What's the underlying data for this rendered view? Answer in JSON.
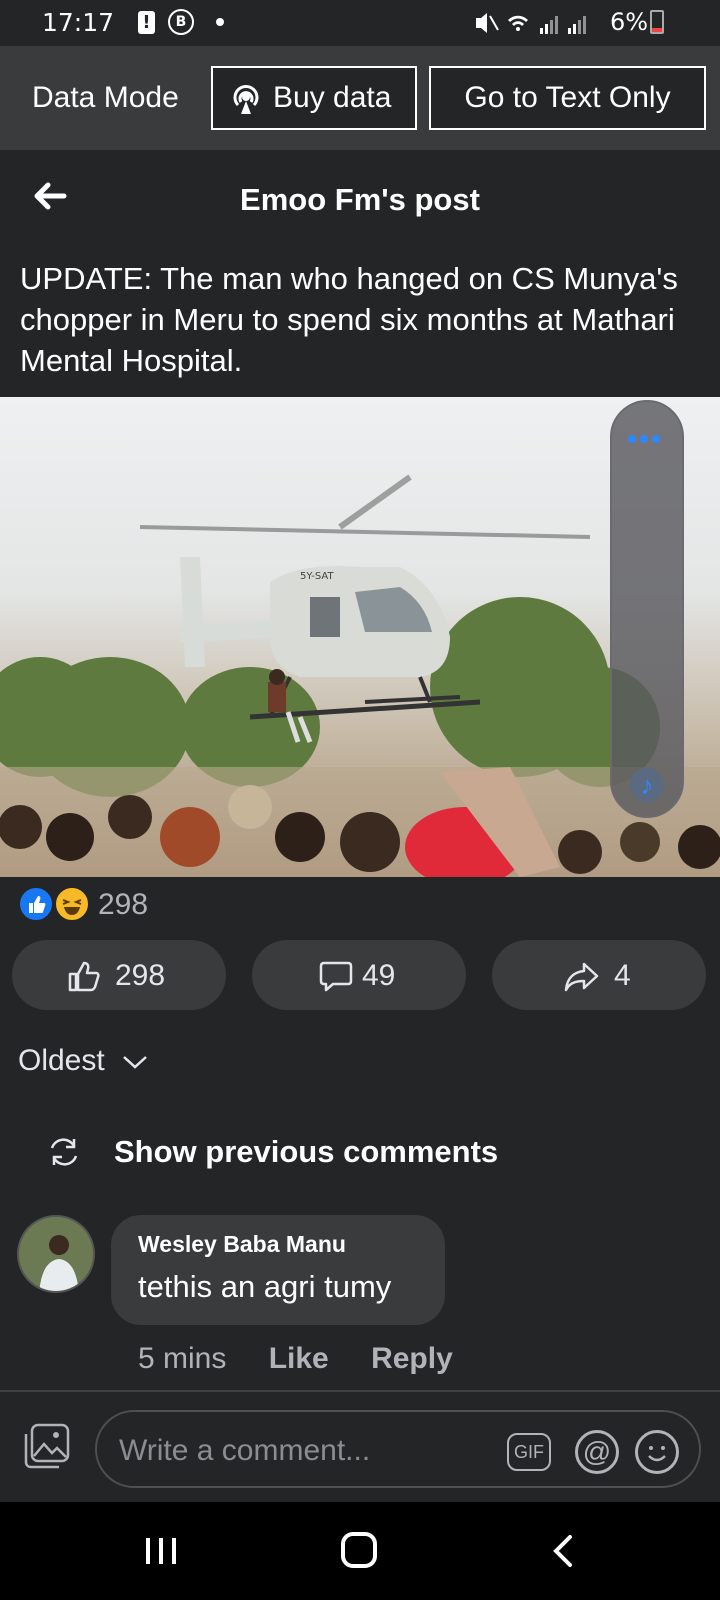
{
  "status_bar": {
    "time": "17:17",
    "notification_b": "B",
    "battery_text": "6%",
    "icons": [
      "alert-icon",
      "b-icon",
      "dot-icon",
      "mute-icon",
      "wifi-icon",
      "signal-icon",
      "signal-icon",
      "battery-icon"
    ]
  },
  "data_mode": {
    "label": "Data Mode",
    "buy_label": "Buy data",
    "text_only_label": "Go to Text Only"
  },
  "header": {
    "title": "Emoo Fm's post"
  },
  "post": {
    "text": "UPDATE: The man who hanged on CS Munya's chopper in Meru to spend six months at Mathari Mental Hospital.",
    "helicopter_registration": "5Y-SAT"
  },
  "reactions": {
    "count": "298"
  },
  "actions": {
    "like_count": "298",
    "comment_count": "49",
    "share_count": "4"
  },
  "comments": {
    "sort_label": "Oldest",
    "show_previous_label": "Show previous comments",
    "items": [
      {
        "author": "Wesley Baba Manu",
        "text": "tethis an agri tumy",
        "time": "5 mins",
        "like_label": "Like",
        "reply_label": "Reply"
      }
    ]
  },
  "composer": {
    "placeholder": "Write a comment...",
    "gif_label": "GIF",
    "mention_label": "@"
  },
  "colors": {
    "background": "#242526",
    "surface": "#3a3b3c",
    "accent": "#1877f2",
    "haha": "#f7b928"
  }
}
